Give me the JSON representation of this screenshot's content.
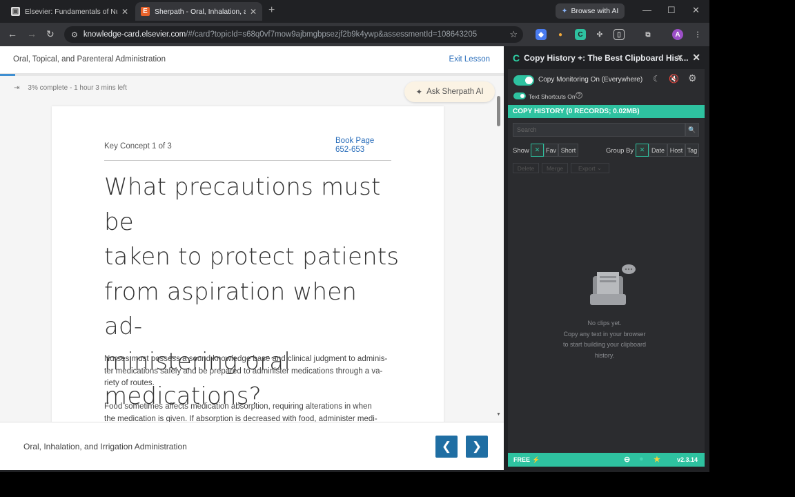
{
  "tabs": [
    {
      "title": "Elsevier: Fundamentals of Nurs",
      "active": false
    },
    {
      "title": "Sherpath - Oral, Inhalation, and",
      "active": true
    }
  ],
  "browse_ai": "Browse with AI",
  "address": {
    "host": "knowledge-card.elsevier.com",
    "path": "/#/card?topicId=s68q0vf7mow9ajbmgbpsezjf2b9k4ywp&assessmentId=108643205"
  },
  "page": {
    "course_title": "Oral, Topical, and Parenteral Administration",
    "exit_label": "Exit Lesson",
    "progress_percent": 3,
    "progress_text": "3% complete - 1 hour 3 mins left",
    "ask_ai": "Ask Sherpath AI",
    "card": {
      "key_concept": "Key Concept 1 of 3",
      "book_page_label": "Book Page",
      "book_page_range": "652-653",
      "question_lines": [
        "What precautions must be",
        "taken to protect patients",
        "from aspiration when ad-",
        "ministering oral",
        "medications?"
      ],
      "para1_lines": [
        "Nurses must possess a sound knowledge base and clinical judgment to adminis-",
        "ter medications safely and be prepared to administer medications through a va-",
        "riety of routes."
      ],
      "para2_lines": [
        "Food sometimes affects medication absorption, requiring alterations in when",
        "the medication is given. If absorption is decreased with food, administer medi-"
      ]
    },
    "footer_lesson": "Oral, Inhalation, and Irrigation Administration"
  },
  "panel": {
    "title": "Copy History +: The Best Clipboard Hist...",
    "monitoring": "Copy Monitoring On (Everywhere)",
    "shortcuts": "Text Shortcuts On",
    "history_bar": "COPY HISTORY (0 RECORDS; 0.02MB)",
    "search_placeholder": "Search",
    "show_label": "Show",
    "show_chips": [
      "Fav",
      "Short"
    ],
    "group_label": "Group By",
    "group_chips": [
      "Date",
      "Host",
      "Tag"
    ],
    "actions": [
      "Delete",
      "Merge",
      "Export"
    ],
    "empty_lines": [
      "No clips yet.",
      "Copy any text in your browser",
      "to start building your clipboard",
      "history."
    ],
    "footer_plan": "FREE",
    "version": "v2.3.14"
  },
  "colors": {
    "accent": "#2ec2a0",
    "link": "#2a6ebb",
    "nav_button": "#1f6ea3"
  }
}
